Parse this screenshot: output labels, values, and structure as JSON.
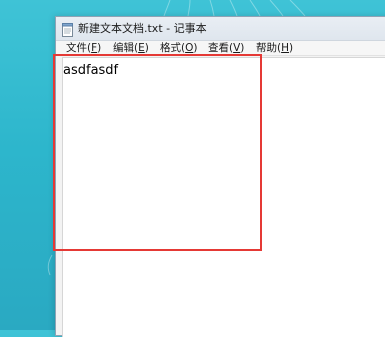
{
  "window": {
    "title": "新建文本文档.txt - 记事本"
  },
  "menu": {
    "items": [
      {
        "label": "文件(",
        "mnemonic": "F",
        "close": ")"
      },
      {
        "label": "编辑(",
        "mnemonic": "E",
        "close": ")"
      },
      {
        "label": "格式(",
        "mnemonic": "O",
        "close": ")"
      },
      {
        "label": "查看(",
        "mnemonic": "V",
        "close": ")"
      },
      {
        "label": "帮助(",
        "mnemonic": "H",
        "close": ")"
      }
    ]
  },
  "editor": {
    "content": "asdfasdf"
  },
  "icons": {
    "app": "notepad-icon"
  },
  "colors": {
    "highlight": "#e53935",
    "desktop": "#2db6cc"
  }
}
